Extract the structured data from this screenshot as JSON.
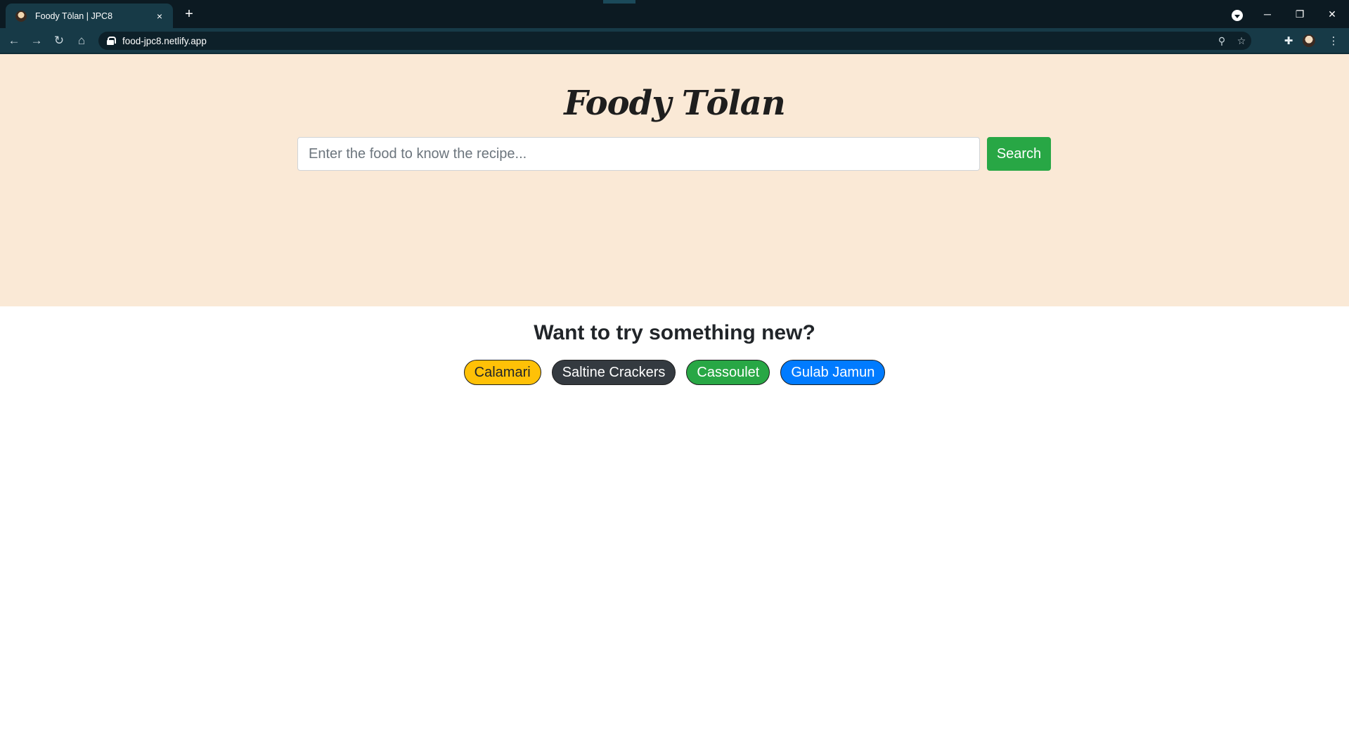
{
  "browser": {
    "tab_title": "Foody Tōlan | JPC8",
    "tab_close_icon": "×",
    "new_tab_icon": "+",
    "url": "food-jpc8.netlify.app",
    "window_controls": {
      "minimize": "─",
      "restore": "❐",
      "close": "✕"
    },
    "nav": {
      "back": "←",
      "forward": "→",
      "reload": "↻",
      "home": "⌂"
    },
    "omnibox_icons": {
      "zoom": "⚲",
      "bookmark": "☆"
    },
    "extensions_icon": "✚",
    "menu_icon": "⋮"
  },
  "hero": {
    "title": "Foody Tōlan",
    "search_placeholder": "Enter the food to know the recipe...",
    "search_value": "",
    "search_button": "Search",
    "background_color": "#fae9d6"
  },
  "suggestions": {
    "heading": "Want to try something new?",
    "items": [
      {
        "label": "Calamari",
        "bg": "#ffc107",
        "fg": "#212529"
      },
      {
        "label": "Saltine Crackers",
        "bg": "#343a40",
        "fg": "#ffffff"
      },
      {
        "label": "Cassoulet",
        "bg": "#28a745",
        "fg": "#ffffff"
      },
      {
        "label": "Gulab Jamun",
        "bg": "#007bff",
        "fg": "#ffffff"
      }
    ]
  }
}
